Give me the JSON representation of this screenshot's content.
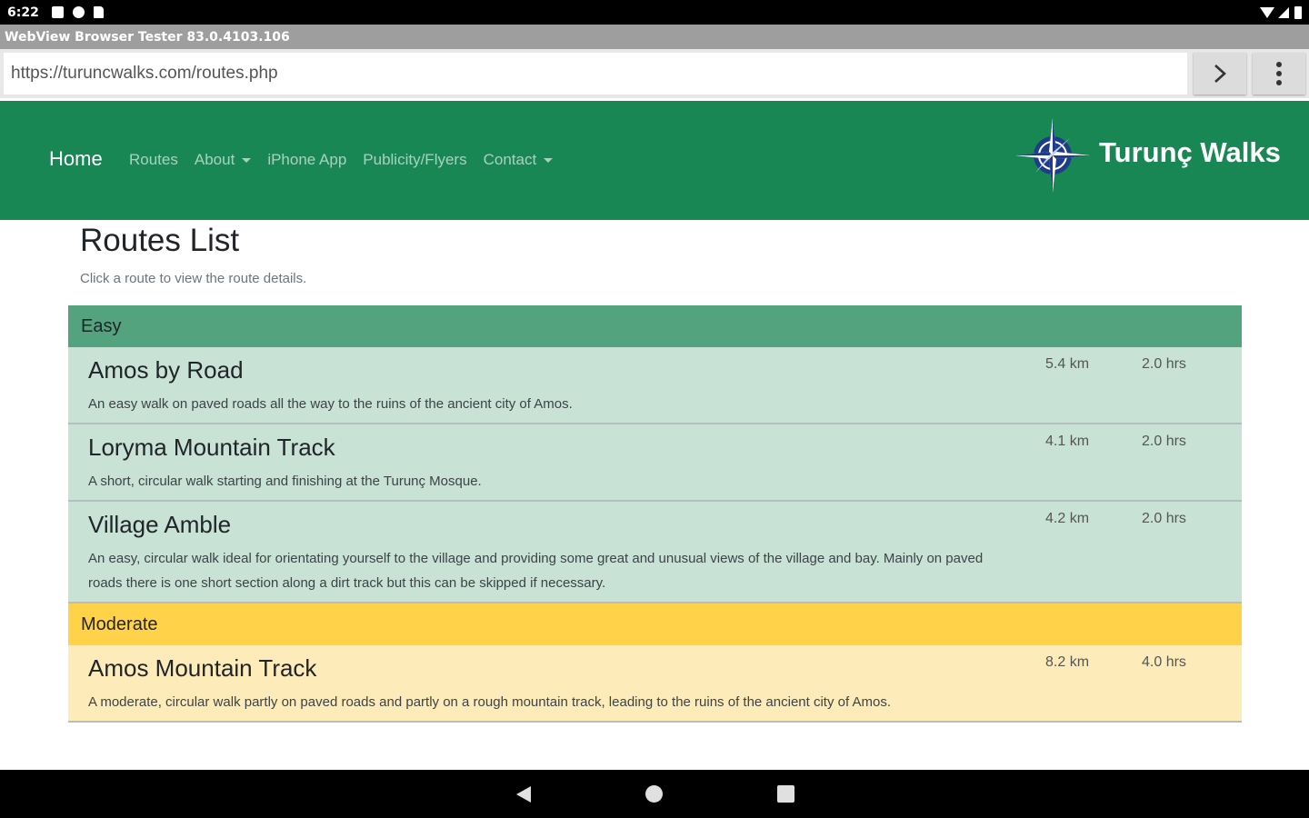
{
  "status_bar": {
    "time": "6:22"
  },
  "app_title": "WebView Browser Tester 83.0.4103.106",
  "url_bar": {
    "value": "https://turuncwalks.com/routes.php"
  },
  "nav": {
    "brand": "Home",
    "links": [
      {
        "label": "Routes",
        "dropdown": false
      },
      {
        "label": "About",
        "dropdown": true
      },
      {
        "label": "iPhone App",
        "dropdown": false
      },
      {
        "label": "Publicity/Flyers",
        "dropdown": false
      },
      {
        "label": "Contact",
        "dropdown": true
      }
    ],
    "site_name": "Turunç Walks"
  },
  "page": {
    "heading": "Routes List",
    "subtitle": "Click a route to view the route details."
  },
  "groups": [
    {
      "name": "Easy",
      "color": "#52a37e",
      "row_color": "#c8e2d5",
      "routes": [
        {
          "name": "Amos by Road",
          "distance": "5.4 km",
          "time": "2.0 hrs",
          "description": "An easy walk on paved roads all the way to the ruins of the ancient city of Amos."
        },
        {
          "name": "Loryma Mountain Track",
          "distance": "4.1 km",
          "time": "2.0 hrs",
          "description": "A short, circular walk starting and finishing at the Turunç Mosque."
        },
        {
          "name": "Village Amble",
          "distance": "4.2 km",
          "time": "2.0 hrs",
          "description": "An easy, circular walk ideal for orientating yourself to the village and providing some great and unusual views of the village and bay. Mainly on paved roads there is one short section along a dirt track but this can be skipped if necessary."
        }
      ]
    },
    {
      "name": "Moderate",
      "color": "#ffd24a",
      "row_color": "#fdecb9",
      "routes": [
        {
          "name": "Amos Mountain Track",
          "distance": "8.2 km",
          "time": "4.0 hrs",
          "description": "A moderate, circular walk partly on paved roads and partly on a rough mountain track, leading to the ruins of the ancient city of Amos."
        }
      ]
    }
  ],
  "colors": {
    "navbar": "#198754",
    "status_bar": "#000000",
    "title_bar": "#9e9e9e"
  },
  "icons": {
    "go": "chevron-right-icon",
    "menu": "more-vertical-icon",
    "logo": "compass-rose-icon",
    "android_back": "back-triangle-icon",
    "android_home": "home-circle-icon",
    "android_recent": "recents-square-icon"
  }
}
